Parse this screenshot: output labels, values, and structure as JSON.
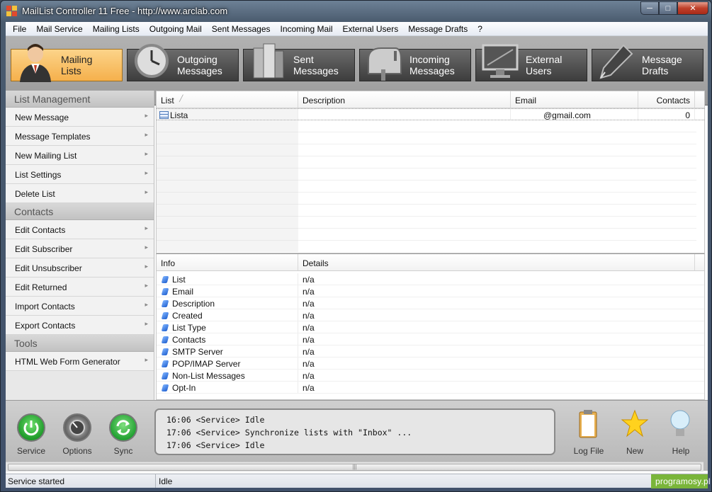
{
  "window": {
    "title": "MailList Controller 11 Free - http://www.arclab.com"
  },
  "menu": [
    "File",
    "Mail Service",
    "Mailing Lists",
    "Outgoing Mail",
    "Sent Messages",
    "Incoming Mail",
    "External Users",
    "Message Drafts",
    "?"
  ],
  "toolbar": {
    "buttons": [
      {
        "label": "Mailing\nLists",
        "l1": "Mailing",
        "l2": "Lists",
        "active": true
      },
      {
        "l1": "Outgoing",
        "l2": "Messages"
      },
      {
        "l1": "Sent",
        "l2": "Messages"
      },
      {
        "l1": "Incoming",
        "l2": "Messages"
      },
      {
        "l1": "External",
        "l2": "Users"
      },
      {
        "l1": "Message",
        "l2": "Drafts"
      }
    ]
  },
  "sidebar": {
    "sections": [
      {
        "title": "List Management",
        "items": [
          "New Message",
          "Message Templates",
          "New Mailing List",
          "List Settings",
          "Delete List"
        ]
      },
      {
        "title": "Contacts",
        "items": [
          "Edit Contacts",
          "Edit Subscriber",
          "Edit Unsubscriber",
          "Edit Returned",
          "Import Contacts",
          "Export Contacts"
        ]
      },
      {
        "title": "Tools",
        "items": [
          "HTML Web Form Generator"
        ]
      }
    ]
  },
  "list_grid": {
    "headers": [
      "List",
      "Description",
      "Email",
      "Contacts"
    ],
    "rows": [
      {
        "list": "Lista",
        "description": "",
        "email": "@gmail.com",
        "contacts": "0"
      }
    ]
  },
  "info_grid": {
    "headers": [
      "Info",
      "Details"
    ],
    "rows": [
      {
        "info": "List",
        "details": "n/a"
      },
      {
        "info": "Email",
        "details": "n/a"
      },
      {
        "info": "Description",
        "details": "n/a"
      },
      {
        "info": "Created",
        "details": "n/a"
      },
      {
        "info": "List Type",
        "details": "n/a"
      },
      {
        "info": "Contacts",
        "details": "n/a"
      },
      {
        "info": "SMTP Server",
        "details": "n/a"
      },
      {
        "info": "POP/IMAP Server",
        "details": "n/a"
      },
      {
        "info": "Non-List Messages",
        "details": "n/a"
      },
      {
        "info": "Opt-In",
        "details": "n/a"
      }
    ]
  },
  "bottom": {
    "left_buttons": [
      "Service",
      "Options",
      "Sync"
    ],
    "right_buttons": [
      "Log File",
      "New",
      "Help"
    ],
    "log": [
      "16:06 <Service> Idle",
      "17:06 <Service> Synchronize lists with \"Inbox\" ...",
      "17:06 <Service> Idle"
    ]
  },
  "status": {
    "left": "Service started",
    "right": "Idle",
    "watermark": "programosy.pl"
  },
  "colors": {
    "active_tab": "#f5b04c",
    "accent_green": "#2eaa3a"
  }
}
